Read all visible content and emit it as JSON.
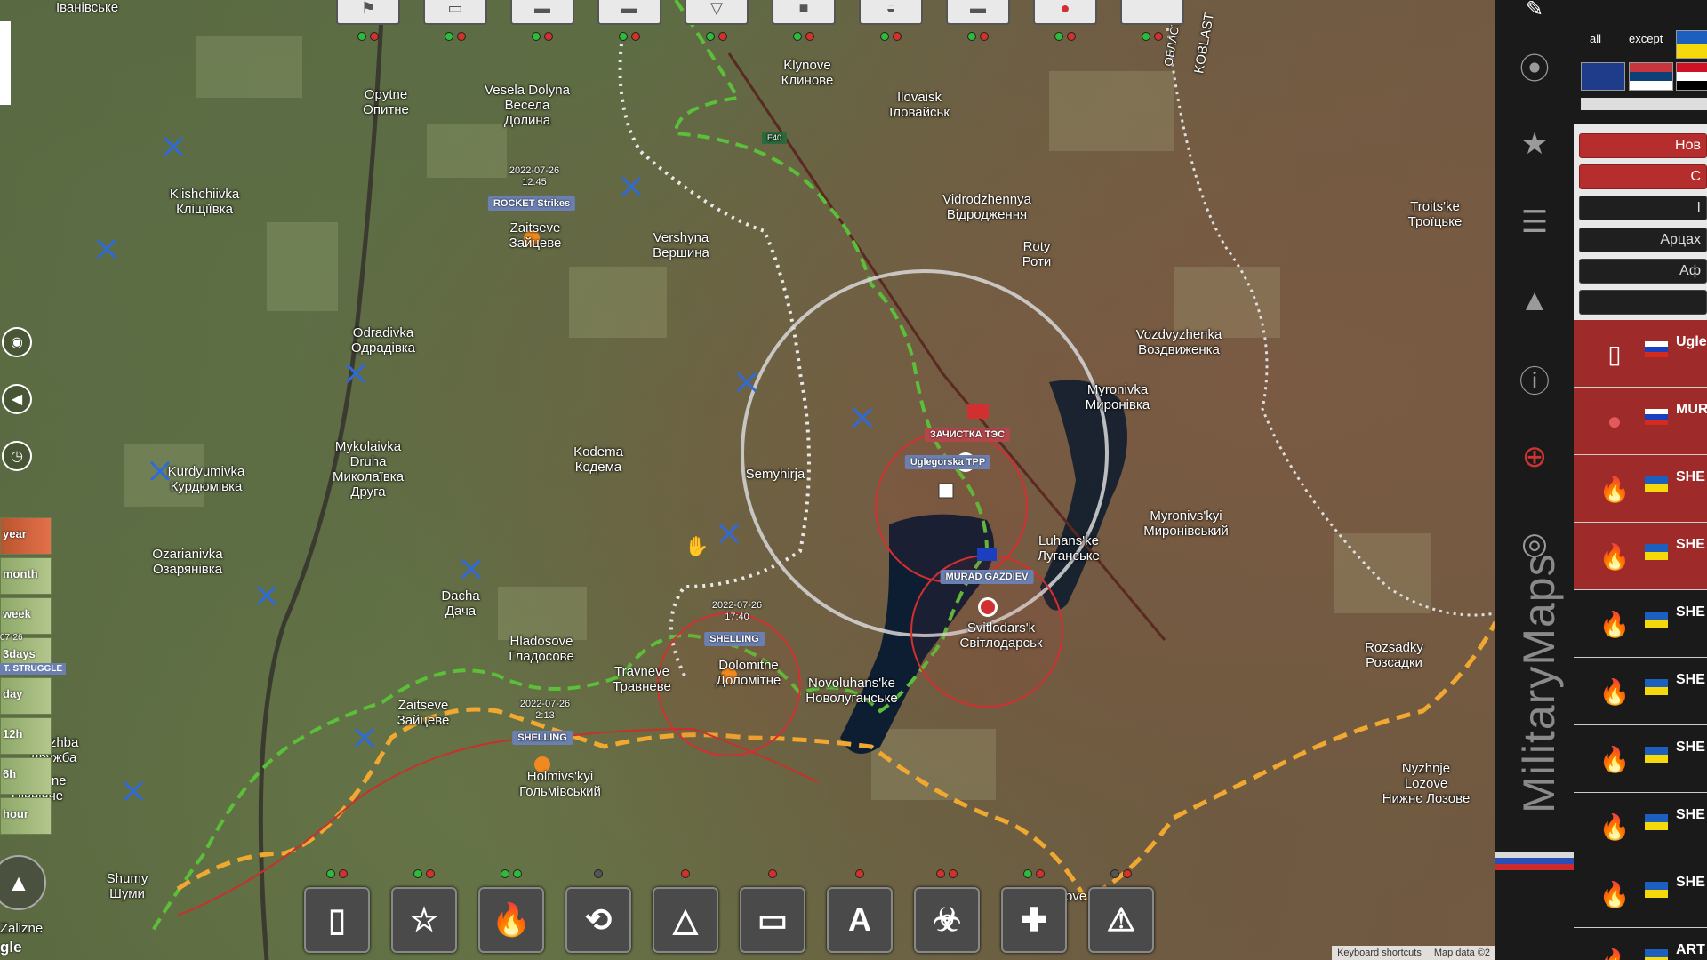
{
  "map": {
    "places": [
      {
        "id": "ivanivske",
        "text": "Іванівське"
      },
      {
        "id": "opytne",
        "text": "Opytne\nОпитне"
      },
      {
        "id": "vesela",
        "text": "Vesela Dolyna\nВесела\nДолина"
      },
      {
        "id": "klynove",
        "text": "Klynove\nКлинове"
      },
      {
        "id": "ilovaisk",
        "text": "Ilovaisk\nІловайськ"
      },
      {
        "id": "klishchiivka",
        "text": "Klishchiivka\nКліщіївка"
      },
      {
        "id": "zaitseve1",
        "text": "Zaitseve\nЗайцеве"
      },
      {
        "id": "vershyna",
        "text": "Vershyna\nВершина"
      },
      {
        "id": "vidrodzhennya",
        "text": "Vidrodzhennya\nВідродження"
      },
      {
        "id": "troitske",
        "text": "Troits'ke\nТроїцьке"
      },
      {
        "id": "roty",
        "text": "Roty\nРоти"
      },
      {
        "id": "odradivka",
        "text": "Odradivka\nОдрадівка"
      },
      {
        "id": "vozdvyzhenka",
        "text": "Vozdvyzhenka\nВоздвиженка"
      },
      {
        "id": "myronivka",
        "text": "Myronivka\nМиронівка"
      },
      {
        "id": "mykolaivka",
        "text": "Mykolaivka\nDruha\nМиколаївка\nДруга"
      },
      {
        "id": "kurdyumivka",
        "text": "Kurdyumivka\nКурдюмівка"
      },
      {
        "id": "kodema",
        "text": "Kodema\nКодема"
      },
      {
        "id": "semyhirja",
        "text": "Semyhirja"
      },
      {
        "id": "myronivskyi",
        "text": "Myronivs'kyi\nМиронівський"
      },
      {
        "id": "luhanske",
        "text": "Luhans'ke\nЛуганське"
      },
      {
        "id": "ozarianivka",
        "text": "Ozarianivka\nОзарянівка"
      },
      {
        "id": "dacha",
        "text": "Dacha\nДача"
      },
      {
        "id": "hladosove",
        "text": "Hladosove\nГладосове"
      },
      {
        "id": "travneve",
        "text": "Travneve\nТравневе"
      },
      {
        "id": "dolomitne",
        "text": "Dolomitne\nДоломітне"
      },
      {
        "id": "novoluhanske",
        "text": "Novoluhans'ke\nНоволуганське"
      },
      {
        "id": "svitlodarsk",
        "text": "Svitlodars'k\nСвітлодарськ"
      },
      {
        "id": "rozsadky",
        "text": "Rozsadky\nРозсадки"
      },
      {
        "id": "zaitseve2",
        "text": "Zaitseve\nЗайцеве"
      },
      {
        "id": "druzhba",
        "text": "Druzhba\nДружба"
      },
      {
        "id": "pivnichne",
        "text": "Pivnichne\nПівнічне"
      },
      {
        "id": "holmivskyi",
        "text": "Holmivs'kyi\nГольмівський"
      },
      {
        "id": "nyzhnje",
        "text": "Nyzhnje\nLozove\nНижнє Лозове"
      },
      {
        "id": "shumy",
        "text": "Shumy\nШуми"
      },
      {
        "id": "zalizne",
        "text": "Zalizne"
      },
      {
        "id": "lozove",
        "text": "Lozove"
      },
      {
        "id": "oblast",
        "text": "KOBLAST"
      },
      {
        "id": "oblast2",
        "text": "ОБЛАСТ"
      },
      {
        "id": "e40",
        "text": "E40"
      }
    ],
    "tags": {
      "rocket": "ROCKET Strikes",
      "zachistka": "ЗАЧИСТКА ТЭС",
      "uglegorska": "Uglegorska TPP",
      "murad": "MURAD GAZDIEV",
      "shelling1": "SHELLING",
      "shelling2": "SHELLING"
    },
    "stamps": {
      "s1": "2022-07-26\n12:45",
      "s2": "2022-07-26\n17:40",
      "s3": "2022-07-26\n2:13"
    },
    "time_filter": [
      {
        "label": "year",
        "active": true
      },
      {
        "label": "month",
        "active": false
      },
      {
        "label": "week",
        "active": false
      },
      {
        "label": "3days",
        "active": false
      },
      {
        "label": "day",
        "active": false
      },
      {
        "label": "12h",
        "active": false
      },
      {
        "label": "6h",
        "active": false
      },
      {
        "label": "hour",
        "active": false
      }
    ],
    "time_filter_tag": "T. STRUGGLE",
    "time_filter_sub": "07-26",
    "google_label": "gle",
    "attribution": [
      "Keyboard shortcuts",
      "Map data ©2"
    ]
  },
  "top_toolbar": [
    "flag-icon",
    "truck-icon",
    "apc-icon",
    "tank-icon",
    "missile-icon",
    "artillery-icon",
    "helmet-icon",
    "tank2-icon",
    "soldier-icon",
    "blank-icon"
  ],
  "bottom_toolbar": [
    {
      "name": "fortification-button",
      "glyph": "▯"
    },
    {
      "name": "star-button",
      "glyph": "☆"
    },
    {
      "name": "fire-button",
      "glyph": "🔥"
    },
    {
      "name": "route-button",
      "glyph": "⟲"
    },
    {
      "name": "triangle-button",
      "glyph": "△"
    },
    {
      "name": "ruler-button",
      "glyph": "▭"
    },
    {
      "name": "text-button",
      "glyph": "A"
    },
    {
      "name": "biohazard-button",
      "glyph": "☣"
    },
    {
      "name": "medical-button",
      "glyph": "✚"
    },
    {
      "name": "warning-button",
      "glyph": "⚠"
    }
  ],
  "panel": {
    "brand": "MilitaryMaps",
    "filter_all": "all",
    "filter_except": "except",
    "nav": [
      {
        "label": "Нов",
        "style": "red"
      },
      {
        "label": "С",
        "style": "red"
      },
      {
        "label": "І",
        "style": "dark"
      },
      {
        "label": "Арцах",
        "style": "dark"
      },
      {
        "label": "Аф",
        "style": "dark"
      },
      {
        "label": "",
        "style": "dark"
      }
    ],
    "events": [
      {
        "icon": "fortification-icon",
        "glyph": "▯",
        "flag": "ru",
        "title": "Ugle",
        "red": true
      },
      {
        "icon": "soldier-icon",
        "glyph": "●",
        "flag": "ru",
        "title": "MUR",
        "red": true
      },
      {
        "icon": "fire-icon",
        "glyph": "🔥",
        "flag": "ua",
        "title": "SHE",
        "red": true
      },
      {
        "icon": "fire-icon",
        "glyph": "🔥",
        "flag": "ua",
        "title": "SHE",
        "red": true
      },
      {
        "icon": "fire-icon",
        "glyph": "🔥",
        "flag": "ua",
        "title": "SHE",
        "red": false
      },
      {
        "icon": "fire-icon",
        "glyph": "🔥",
        "flag": "ua",
        "title": "SHE",
        "red": false
      },
      {
        "icon": "fire-icon",
        "glyph": "🔥",
        "flag": "ua",
        "title": "SHE",
        "red": false
      },
      {
        "icon": "fire-icon",
        "glyph": "🔥",
        "flag": "ua",
        "title": "SHE",
        "red": false
      },
      {
        "icon": "fire-icon",
        "glyph": "🔥",
        "flag": "ua",
        "title": "SHE",
        "red": false
      },
      {
        "icon": "fire-icon",
        "glyph": "🔥",
        "flag": "ua",
        "title": "ART",
        "red": false
      }
    ]
  },
  "colors": {
    "ukraine_line": "#5bbf3a",
    "russia_line": "#f0a830",
    "marker_red": "#d23030",
    "unit_blue": "#2f6bd8"
  }
}
